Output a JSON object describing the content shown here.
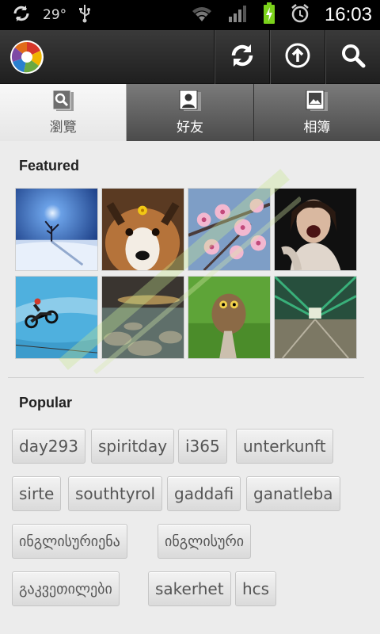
{
  "status_bar": {
    "temperature": "29°",
    "time": "16:03",
    "icons": [
      "sync-icon",
      "usb-icon",
      "wifi-icon",
      "signal-icon",
      "battery-charging-icon",
      "alarm-icon"
    ]
  },
  "action_bar": {
    "logo": "picasa-logo",
    "buttons": [
      "refresh-icon",
      "upload-icon",
      "search-icon"
    ]
  },
  "tabs": [
    {
      "label": "瀏覽",
      "icon": "browse-icon",
      "active": true
    },
    {
      "label": "好友",
      "icon": "friends-icon",
      "active": false
    },
    {
      "label": "相簿",
      "icon": "albums-icon",
      "active": false
    }
  ],
  "featured": {
    "title": "Featured",
    "photos": [
      "snow-tree",
      "dog-with-flower",
      "pink-blossoms",
      "laughing-woman",
      "motocross-jump",
      "rocky-shore-sunset",
      "owl-on-stump",
      "green-bridge"
    ]
  },
  "popular": {
    "title": "Popular",
    "tags": [
      "day293",
      "spiritday",
      "i365",
      "unterkunft",
      "sirte",
      "southtyrol",
      "gaddafi",
      "ganatleba",
      "ინგლისურიენა",
      "ინგლისური",
      "გაკვეთილები",
      "sakerhet",
      "hcs"
    ]
  },
  "colors": {
    "status_bar": "#000000",
    "action_bar": "#2b2b2b",
    "background": "#ececec",
    "tag_text": "#555555"
  }
}
